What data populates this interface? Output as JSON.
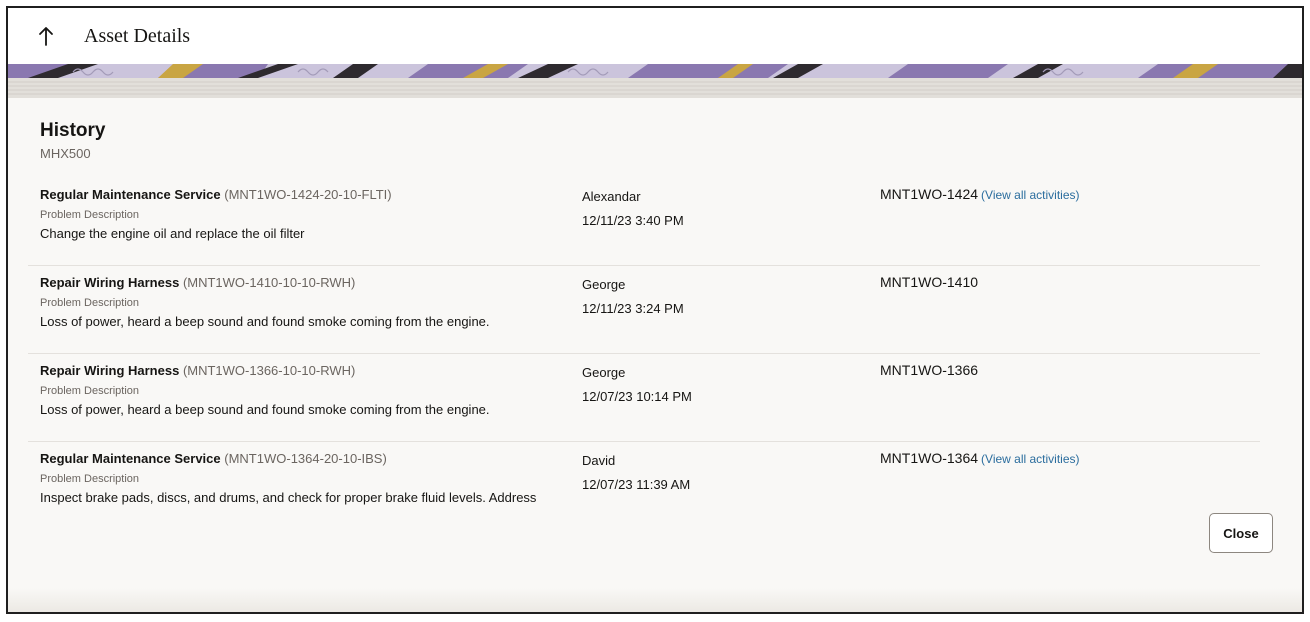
{
  "header": {
    "back_icon": "arrow-up-icon",
    "title": "Asset Details"
  },
  "section": {
    "title": "History",
    "subtitle": "MHX500"
  },
  "history": [
    {
      "name": "Regular Maintenance Service",
      "code": "(MNT1WO-1424-20-10-FLTI)",
      "problem_label": "Problem Description",
      "problem": "Change the engine oil and replace the oil filter",
      "person": "Alexandar",
      "date": "12/11/23 3:40 PM",
      "wo_number": "MNT1WO-1424",
      "link": "(View all activities)"
    },
    {
      "name": "Repair Wiring Harness",
      "code": "(MNT1WO-1410-10-10-RWH)",
      "problem_label": "Problem Description",
      "problem": "Loss of power, heard a beep sound and found smoke coming from the engine.",
      "person": "George",
      "date": "12/11/23 3:24 PM",
      "wo_number": "MNT1WO-1410",
      "link": ""
    },
    {
      "name": "Repair Wiring Harness",
      "code": "(MNT1WO-1366-10-10-RWH)",
      "problem_label": "Problem Description",
      "problem": "Loss of power, heard a beep sound and found smoke coming from the engine.",
      "person": "George",
      "date": "12/07/23 10:14 PM",
      "wo_number": "MNT1WO-1366",
      "link": ""
    },
    {
      "name": "Regular Maintenance Service",
      "code": "(MNT1WO-1364-20-10-IBS)",
      "problem_label": "Problem Description",
      "problem": "Inspect brake pads, discs, and drums, and check for proper brake fluid levels. Address",
      "person": "David",
      "date": "12/07/23 11:39 AM",
      "wo_number": "MNT1WO-1364",
      "link": "(View all activities)"
    }
  ],
  "footer": {
    "close_label": "Close"
  },
  "colors": {
    "link": "#2b6d9e",
    "banner_purple": "#8a78b0",
    "banner_dark": "#2e2a2f",
    "banner_gold": "#c9a543"
  }
}
